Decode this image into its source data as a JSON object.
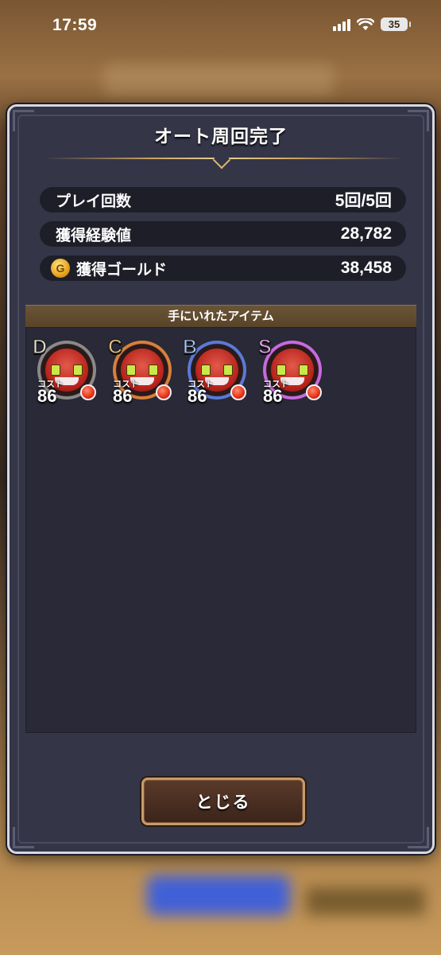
{
  "status_bar": {
    "time": "17:59",
    "battery": "35"
  },
  "dialog": {
    "title": "オート周回完了",
    "stats": [
      {
        "label": "プレイ回数",
        "value": "5回/5回"
      },
      {
        "label": "獲得経験値",
        "value": "28,782"
      },
      {
        "label": "獲得ゴールド",
        "value": "38,458",
        "icon": "gold-coin-icon",
        "icon_text": "G"
      }
    ],
    "items_header": "手にいれたアイテム",
    "items": [
      {
        "rank": "D",
        "cost_label": "コスト",
        "cost": "86",
        "rank_color": "#e8e0d0",
        "ring_color": "#8a8a8a"
      },
      {
        "rank": "C",
        "cost_label": "コスト",
        "cost": "86",
        "rank_color": "#e9c98a",
        "ring_color": "#d9803a"
      },
      {
        "rank": "B",
        "cost_label": "コスト",
        "cost": "86",
        "rank_color": "#a8c4ff",
        "ring_color": "#5a7ad8"
      },
      {
        "rank": "S",
        "cost_label": "コスト",
        "cost": "86",
        "rank_color": "#f0a8ff",
        "ring_color": "#c86ae0"
      }
    ],
    "close_label": "とじる"
  },
  "colors": {
    "dialog_bg": "#353548",
    "stat_row_bg": "#1e1e29",
    "items_header_bg": "#6b5436",
    "button_border": "#c49b6a"
  }
}
